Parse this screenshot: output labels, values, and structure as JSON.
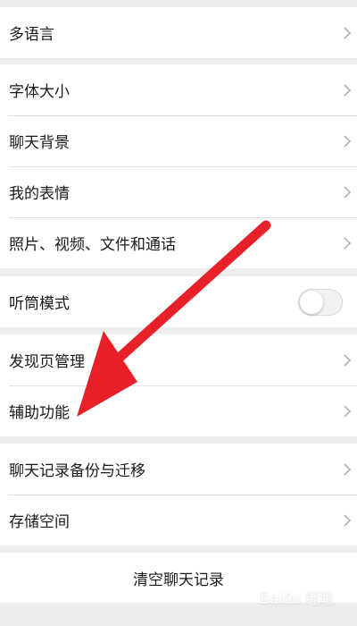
{
  "sections": {
    "language": {
      "label": "多语言"
    },
    "display": {
      "font_size": "字体大小",
      "chat_background": "聊天背景",
      "my_stickers": "我的表情",
      "media": "照片、视频、文件和通话"
    },
    "earpiece": {
      "label": "听筒模式",
      "enabled": false
    },
    "discover": {
      "discover_manage": "发现页管理",
      "accessibility": "辅助功能"
    },
    "storage": {
      "backup": "聊天记录备份与迁移",
      "space": "存储空间"
    },
    "clear": {
      "label": "清空聊天记录"
    }
  },
  "annotation": {
    "arrow_color": "#e8202a"
  },
  "watermark": {
    "text": "Baidu 经验"
  },
  "icons": {
    "chevron": "chevron-right-icon"
  }
}
